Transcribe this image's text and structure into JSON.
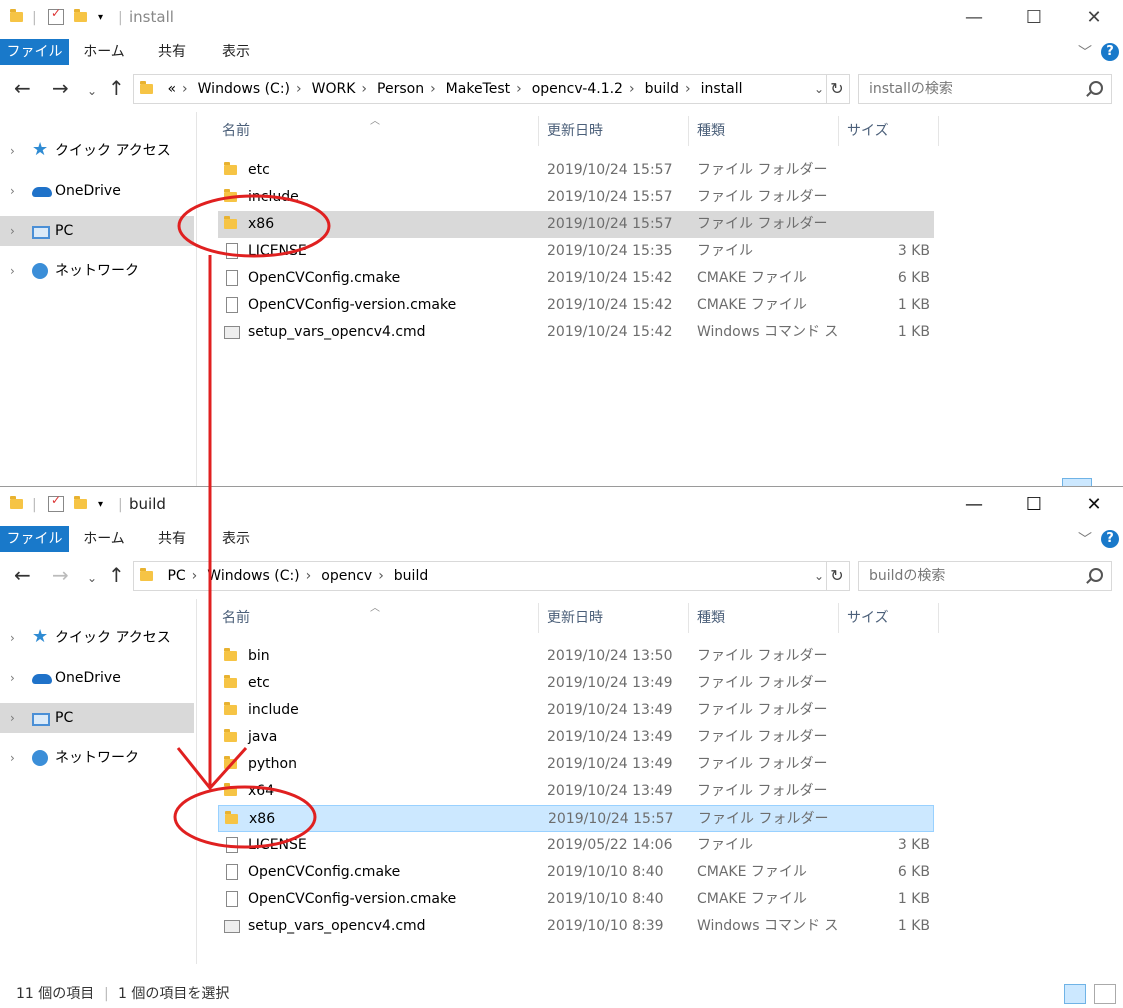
{
  "top_window": {
    "title": "install",
    "ribbon": {
      "file": "ファイル",
      "home": "ホーム",
      "share": "共有",
      "view": "表示"
    },
    "breadcrumb": [
      "«",
      "Windows (C:)",
      "WORK",
      "Person",
      "MakeTest",
      "opencv-4.1.2",
      "build",
      "install"
    ],
    "search_placeholder": "installの検索",
    "columns": {
      "name": "名前",
      "date": "更新日時",
      "type": "種類",
      "size": "サイズ"
    },
    "files": [
      {
        "name": "etc",
        "date": "2019/10/24 15:57",
        "type": "ファイル フォルダー",
        "size": "",
        "icon": "folder-icon"
      },
      {
        "name": "include",
        "date": "2019/10/24 15:57",
        "type": "ファイル フォルダー",
        "size": "",
        "icon": "folder-icon"
      },
      {
        "name": "x86",
        "date": "2019/10/24 15:57",
        "type": "ファイル フォルダー",
        "size": "",
        "icon": "folder-icon"
      },
      {
        "name": "LICENSE",
        "date": "2019/10/24 15:35",
        "type": "ファイル",
        "size": "3 KB",
        "icon": "file-icon"
      },
      {
        "name": "OpenCVConfig.cmake",
        "date": "2019/10/24 15:42",
        "type": "CMAKE ファイル",
        "size": "6 KB",
        "icon": "file-icon"
      },
      {
        "name": "OpenCVConfig-version.cmake",
        "date": "2019/10/24 15:42",
        "type": "CMAKE ファイル",
        "size": "1 KB",
        "icon": "file-icon"
      },
      {
        "name": "setup_vars_opencv4.cmd",
        "date": "2019/10/24 15:42",
        "type": "Windows コマンド ス...",
        "size": "1 KB",
        "icon": "cmd-icon"
      }
    ]
  },
  "bottom_window": {
    "title": "build",
    "ribbon": {
      "file": "ファイル",
      "home": "ホーム",
      "share": "共有",
      "view": "表示"
    },
    "breadcrumb": [
      "PC",
      "Windows (C:)",
      "opencv",
      "build"
    ],
    "search_placeholder": "buildの検索",
    "columns": {
      "name": "名前",
      "date": "更新日時",
      "type": "種類",
      "size": "サイズ"
    },
    "files": [
      {
        "name": "bin",
        "date": "2019/10/24 13:50",
        "type": "ファイル フォルダー",
        "size": "",
        "icon": "folder-icon"
      },
      {
        "name": "etc",
        "date": "2019/10/24 13:49",
        "type": "ファイル フォルダー",
        "size": "",
        "icon": "folder-icon"
      },
      {
        "name": "include",
        "date": "2019/10/24 13:49",
        "type": "ファイル フォルダー",
        "size": "",
        "icon": "folder-icon"
      },
      {
        "name": "java",
        "date": "2019/10/24 13:49",
        "type": "ファイル フォルダー",
        "size": "",
        "icon": "folder-icon"
      },
      {
        "name": "python",
        "date": "2019/10/24 13:49",
        "type": "ファイル フォルダー",
        "size": "",
        "icon": "folder-icon"
      },
      {
        "name": "x64",
        "date": "2019/10/24 13:49",
        "type": "ファイル フォルダー",
        "size": "",
        "icon": "folder-icon"
      },
      {
        "name": "x86",
        "date": "2019/10/24 15:57",
        "type": "ファイル フォルダー",
        "size": "",
        "icon": "folder-icon"
      },
      {
        "name": "LICENSE",
        "date": "2019/05/22 14:06",
        "type": "ファイル",
        "size": "3 KB",
        "icon": "file-icon"
      },
      {
        "name": "OpenCVConfig.cmake",
        "date": "2019/10/10 8:40",
        "type": "CMAKE ファイル",
        "size": "6 KB",
        "icon": "file-icon"
      },
      {
        "name": "OpenCVConfig-version.cmake",
        "date": "2019/10/10 8:40",
        "type": "CMAKE ファイル",
        "size": "1 KB",
        "icon": "file-icon"
      },
      {
        "name": "setup_vars_opencv4.cmd",
        "date": "2019/10/10 8:39",
        "type": "Windows コマンド ス...",
        "size": "1 KB",
        "icon": "cmd-icon"
      }
    ],
    "status": {
      "item_count": "11 個の項目",
      "selected": "1 個の項目を選択"
    }
  },
  "sidebar": {
    "items": [
      {
        "label": "クイック アクセス",
        "icon": "star-icon"
      },
      {
        "label": "OneDrive",
        "icon": "cloud-icon"
      },
      {
        "label": "PC",
        "icon": "pc-icon"
      },
      {
        "label": "ネットワーク",
        "icon": "network-icon"
      }
    ]
  },
  "colors": {
    "accent": "#1979ca",
    "annotation": "#e02020",
    "selected_row": "#cce8ff",
    "hover_row": "#d9d9d9"
  }
}
